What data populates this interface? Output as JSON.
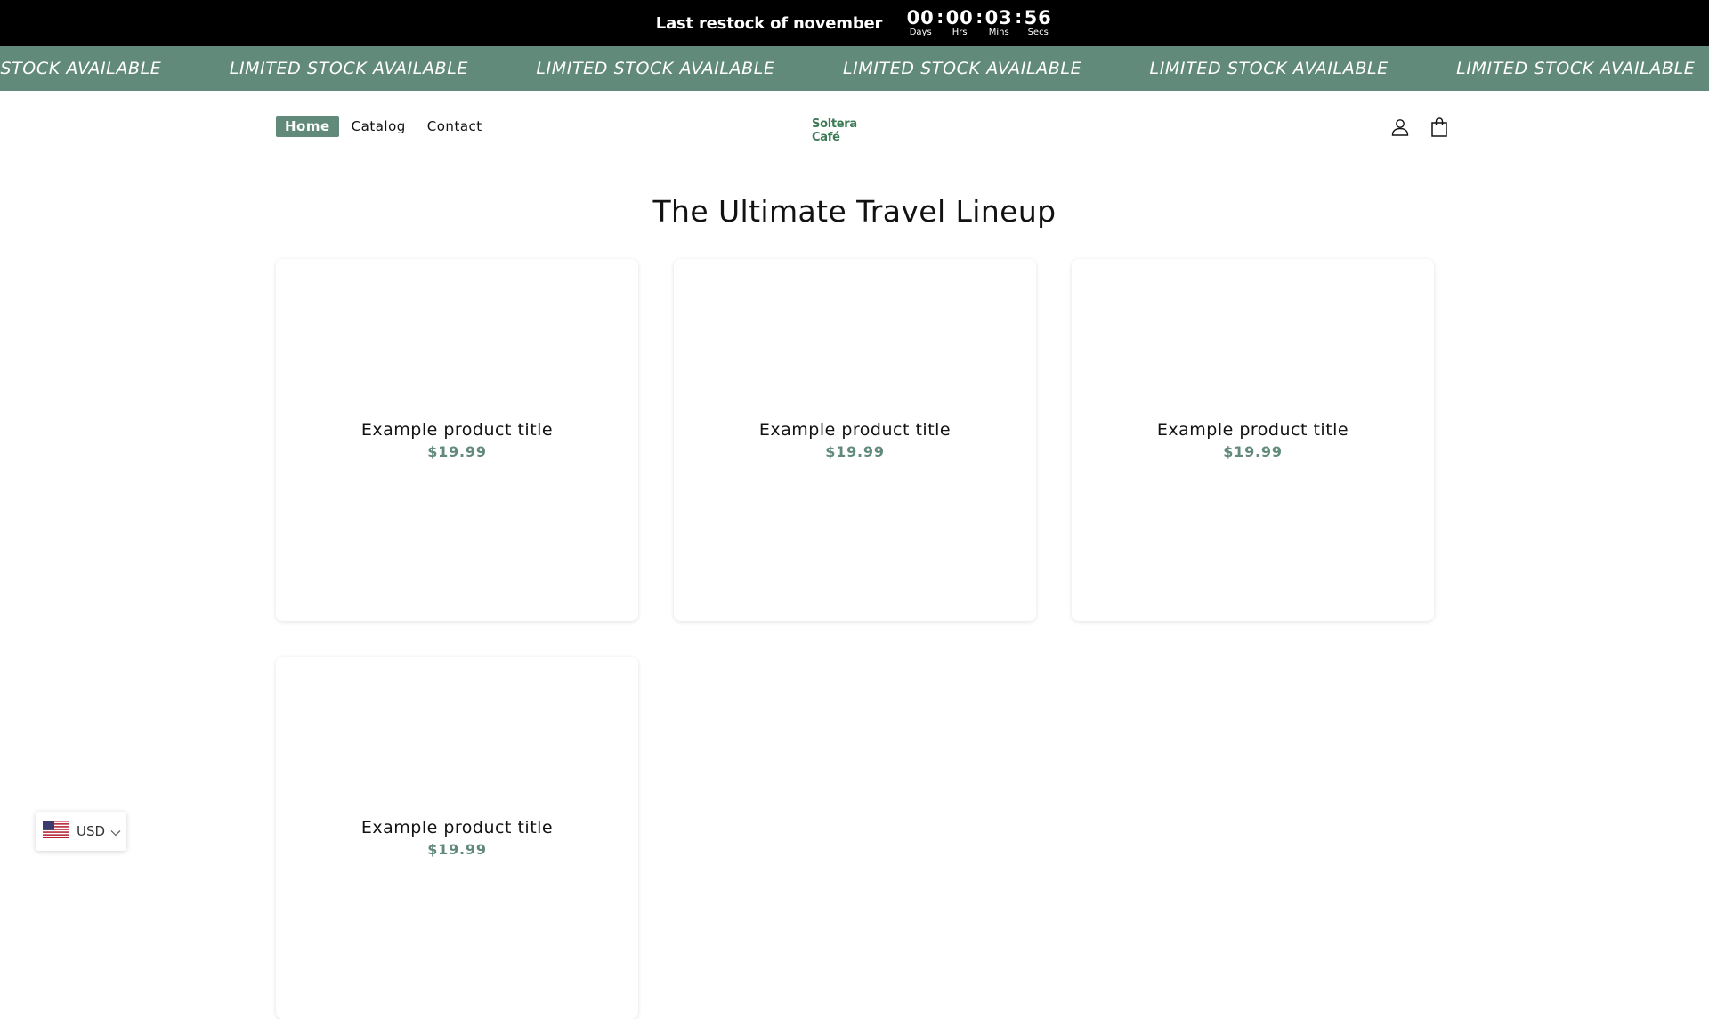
{
  "announcement": {
    "text": "Last restock of november",
    "countdown": [
      {
        "value": "00",
        "label": "Days"
      },
      {
        "value": "00",
        "label": "Hrs"
      },
      {
        "value": "03",
        "label": "Mins"
      },
      {
        "value": "56",
        "label": "Secs"
      }
    ],
    "separator": ":"
  },
  "marquee": {
    "text": "LIMITED STOCK AVAILABLE",
    "background": "#618a7b"
  },
  "nav": {
    "items": [
      {
        "label": "Home",
        "active": true
      },
      {
        "label": "Catalog",
        "active": false
      },
      {
        "label": "Contact",
        "active": false
      }
    ]
  },
  "logo": {
    "text": "Soltera Café"
  },
  "header_icons": [
    "account-icon",
    "cart-icon"
  ],
  "section": {
    "title": "The Ultimate Travel Lineup"
  },
  "products": [
    {
      "title": "Example product title",
      "price": "$19.99"
    },
    {
      "title": "Example product title",
      "price": "$19.99"
    },
    {
      "title": "Example product title",
      "price": "$19.99"
    },
    {
      "title": "Example product title",
      "price": "$19.99"
    }
  ],
  "currency": {
    "code": "USD",
    "flag": "us-flag-icon"
  },
  "colors": {
    "accent": "#618a7b",
    "topbar": "#000000",
    "logo": "#3c7a56"
  }
}
